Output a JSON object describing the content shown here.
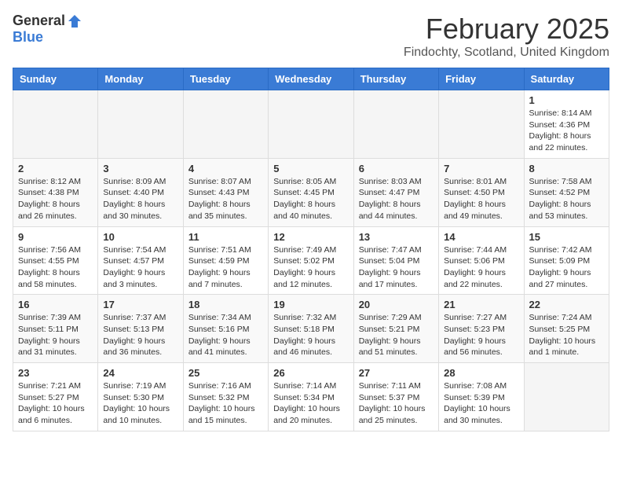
{
  "header": {
    "logo_general": "General",
    "logo_blue": "Blue",
    "month_title": "February 2025",
    "location": "Findochty, Scotland, United Kingdom"
  },
  "days_of_week": [
    "Sunday",
    "Monday",
    "Tuesday",
    "Wednesday",
    "Thursday",
    "Friday",
    "Saturday"
  ],
  "weeks": [
    [
      {
        "day": "",
        "info": ""
      },
      {
        "day": "",
        "info": ""
      },
      {
        "day": "",
        "info": ""
      },
      {
        "day": "",
        "info": ""
      },
      {
        "day": "",
        "info": ""
      },
      {
        "day": "",
        "info": ""
      },
      {
        "day": "1",
        "info": "Sunrise: 8:14 AM\nSunset: 4:36 PM\nDaylight: 8 hours and 22 minutes."
      }
    ],
    [
      {
        "day": "2",
        "info": "Sunrise: 8:12 AM\nSunset: 4:38 PM\nDaylight: 8 hours and 26 minutes."
      },
      {
        "day": "3",
        "info": "Sunrise: 8:09 AM\nSunset: 4:40 PM\nDaylight: 8 hours and 30 minutes."
      },
      {
        "day": "4",
        "info": "Sunrise: 8:07 AM\nSunset: 4:43 PM\nDaylight: 8 hours and 35 minutes."
      },
      {
        "day": "5",
        "info": "Sunrise: 8:05 AM\nSunset: 4:45 PM\nDaylight: 8 hours and 40 minutes."
      },
      {
        "day": "6",
        "info": "Sunrise: 8:03 AM\nSunset: 4:47 PM\nDaylight: 8 hours and 44 minutes."
      },
      {
        "day": "7",
        "info": "Sunrise: 8:01 AM\nSunset: 4:50 PM\nDaylight: 8 hours and 49 minutes."
      },
      {
        "day": "8",
        "info": "Sunrise: 7:58 AM\nSunset: 4:52 PM\nDaylight: 8 hours and 53 minutes."
      }
    ],
    [
      {
        "day": "9",
        "info": "Sunrise: 7:56 AM\nSunset: 4:55 PM\nDaylight: 8 hours and 58 minutes."
      },
      {
        "day": "10",
        "info": "Sunrise: 7:54 AM\nSunset: 4:57 PM\nDaylight: 9 hours and 3 minutes."
      },
      {
        "day": "11",
        "info": "Sunrise: 7:51 AM\nSunset: 4:59 PM\nDaylight: 9 hours and 7 minutes."
      },
      {
        "day": "12",
        "info": "Sunrise: 7:49 AM\nSunset: 5:02 PM\nDaylight: 9 hours and 12 minutes."
      },
      {
        "day": "13",
        "info": "Sunrise: 7:47 AM\nSunset: 5:04 PM\nDaylight: 9 hours and 17 minutes."
      },
      {
        "day": "14",
        "info": "Sunrise: 7:44 AM\nSunset: 5:06 PM\nDaylight: 9 hours and 22 minutes."
      },
      {
        "day": "15",
        "info": "Sunrise: 7:42 AM\nSunset: 5:09 PM\nDaylight: 9 hours and 27 minutes."
      }
    ],
    [
      {
        "day": "16",
        "info": "Sunrise: 7:39 AM\nSunset: 5:11 PM\nDaylight: 9 hours and 31 minutes."
      },
      {
        "day": "17",
        "info": "Sunrise: 7:37 AM\nSunset: 5:13 PM\nDaylight: 9 hours and 36 minutes."
      },
      {
        "day": "18",
        "info": "Sunrise: 7:34 AM\nSunset: 5:16 PM\nDaylight: 9 hours and 41 minutes."
      },
      {
        "day": "19",
        "info": "Sunrise: 7:32 AM\nSunset: 5:18 PM\nDaylight: 9 hours and 46 minutes."
      },
      {
        "day": "20",
        "info": "Sunrise: 7:29 AM\nSunset: 5:21 PM\nDaylight: 9 hours and 51 minutes."
      },
      {
        "day": "21",
        "info": "Sunrise: 7:27 AM\nSunset: 5:23 PM\nDaylight: 9 hours and 56 minutes."
      },
      {
        "day": "22",
        "info": "Sunrise: 7:24 AM\nSunset: 5:25 PM\nDaylight: 10 hours and 1 minute."
      }
    ],
    [
      {
        "day": "23",
        "info": "Sunrise: 7:21 AM\nSunset: 5:27 PM\nDaylight: 10 hours and 6 minutes."
      },
      {
        "day": "24",
        "info": "Sunrise: 7:19 AM\nSunset: 5:30 PM\nDaylight: 10 hours and 10 minutes."
      },
      {
        "day": "25",
        "info": "Sunrise: 7:16 AM\nSunset: 5:32 PM\nDaylight: 10 hours and 15 minutes."
      },
      {
        "day": "26",
        "info": "Sunrise: 7:14 AM\nSunset: 5:34 PM\nDaylight: 10 hours and 20 minutes."
      },
      {
        "day": "27",
        "info": "Sunrise: 7:11 AM\nSunset: 5:37 PM\nDaylight: 10 hours and 25 minutes."
      },
      {
        "day": "28",
        "info": "Sunrise: 7:08 AM\nSunset: 5:39 PM\nDaylight: 10 hours and 30 minutes."
      },
      {
        "day": "",
        "info": ""
      }
    ]
  ]
}
